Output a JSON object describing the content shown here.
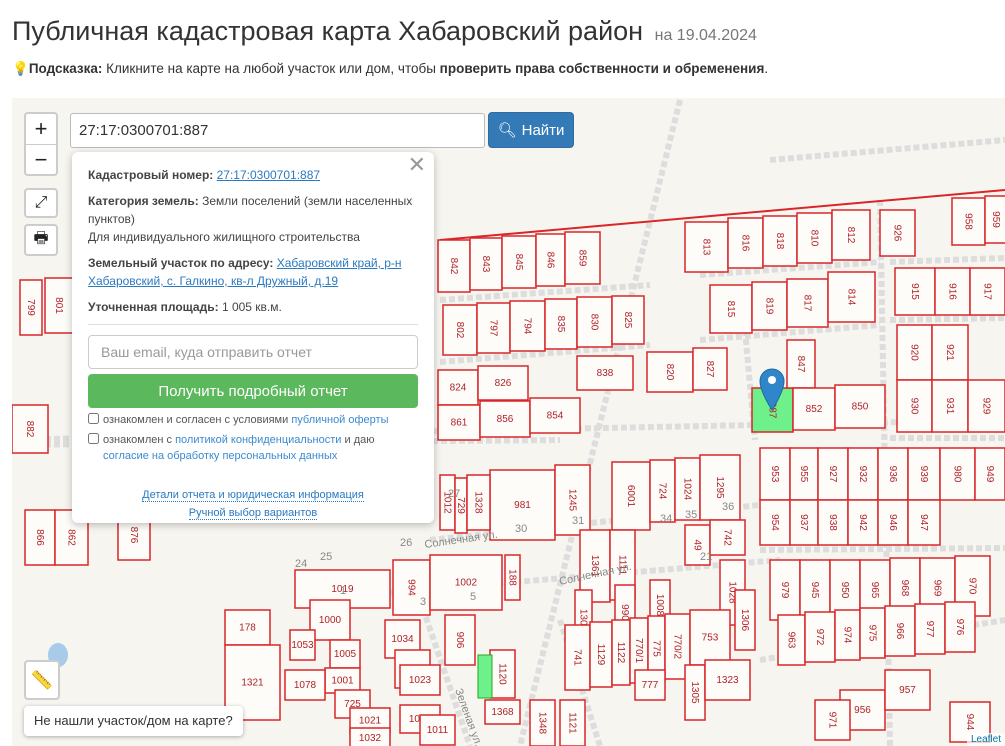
{
  "header": {
    "title": "Публичная кадастровая карта Хабаровский район",
    "date": "на 19.04.2024"
  },
  "hint": {
    "label": "Подсказка:",
    "text": " Кликните на карте на любой участок или дом, чтобы ",
    "bold": "проверить права собственности и обременения",
    "end": "."
  },
  "search": {
    "value": "27:17:0300701:887",
    "button": "Найти"
  },
  "controls": {
    "zoom_in": "+",
    "zoom_out": "−"
  },
  "popup": {
    "cad_label": "Кадастровый номер:",
    "cad_value": "27:17:0300701:887",
    "cat_label": "Категория земель:",
    "cat_value": "Земли поселений (земли населенных пунктов)",
    "use": "Для индивидуального жилищного строительства",
    "addr_label": "Земельный участок по адресу:",
    "addr_value": "Хабаровский край, р-н Хабаровский, с. Галкино, кв-л Дружный, д.19",
    "area_label": "Уточненная площадь:",
    "area_value": "1 005 кв.м.",
    "email_placeholder": "Ваш email, куда отправить отчет",
    "report_button": "Получить подробный отчет",
    "chk1_text": "ознакомлен и согласен с условиями ",
    "chk1_link": "публичной оферты",
    "chk2_text": "ознакомлен с ",
    "chk2_link": "политикой конфиденциальности",
    "chk2_mid": " и даю ",
    "chk2_link2": "согласие на обработку персональных данных",
    "link_details": "Детали отчета и юридическая информация",
    "link_manual": "Ручной выбор вариантов"
  },
  "map": {
    "parcels": [
      "842",
      "843",
      "845",
      "846",
      "859",
      "802",
      "797",
      "794",
      "835",
      "830",
      "825",
      "824",
      "826",
      "838",
      "861",
      "856",
      "854",
      "820",
      "827",
      "813",
      "816",
      "818",
      "810",
      "812",
      "815",
      "819",
      "817",
      "814",
      "887",
      "847",
      "852",
      "850",
      "926",
      "958",
      "959",
      "915",
      "916",
      "917",
      "920",
      "921",
      "930",
      "931",
      "929",
      "953",
      "955",
      "927",
      "932",
      "936",
      "939",
      "980",
      "954",
      "937",
      "938",
      "942",
      "946",
      "947",
      "949",
      "979",
      "945",
      "950",
      "965",
      "968",
      "969",
      "970",
      "963",
      "972",
      "974",
      "975",
      "966",
      "977",
      "976",
      "956",
      "957",
      "971",
      "944",
      "981",
      "1245",
      "1012",
      "729",
      "1328",
      "6001",
      "724",
      "1024",
      "1295",
      "1361",
      "1111",
      "49",
      "742",
      "866",
      "862",
      "876",
      "1019",
      "994",
      "1002",
      "188",
      "1308",
      "990",
      "1008",
      "1028",
      "1306",
      "741",
      "1129",
      "1122",
      "770/1",
      "775",
      "770/2",
      "753",
      "178",
      "1321",
      "1000",
      "1053",
      "1005",
      "1001",
      "1078",
      "725",
      "1021",
      "1032",
      "1034",
      "727",
      "1023",
      "1023",
      "1011",
      "906",
      "1120",
      "1368",
      "777",
      "1305",
      "1323",
      "1348",
      "1121",
      "799",
      "801",
      "882"
    ],
    "streets": [
      "Солнечная ул.",
      "Солнечная ул.",
      "Зеленая ул."
    ],
    "numbers": [
      "26",
      "25",
      "24",
      "30",
      "31",
      "34",
      "35",
      "36",
      "27",
      "21",
      "1",
      "3",
      "5"
    ],
    "colors": {
      "parcel": "#d9262a",
      "selected": "#6ef08a",
      "marker": "#2f86c9"
    }
  },
  "bottom": {
    "not_found": "Не нашли участок/дом на карте?",
    "attribution": "Leaflet"
  }
}
